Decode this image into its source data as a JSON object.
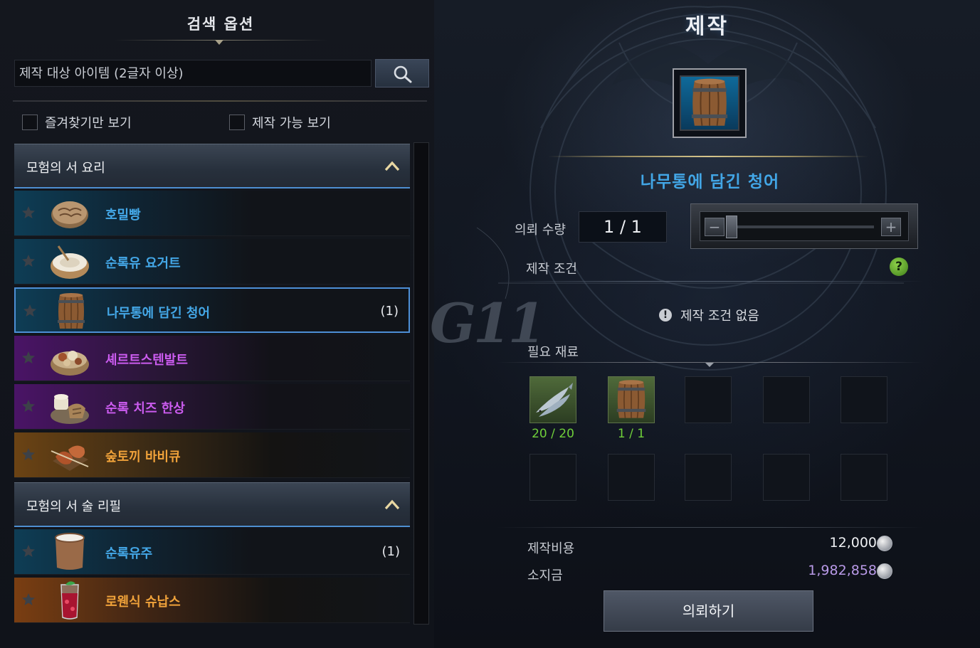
{
  "search_panel": {
    "title": "검색 옵션",
    "input_placeholder": "제작 대상 아이템 (2글자 이상)",
    "search_icon": "magnifier-icon",
    "filters": [
      {
        "label": "즐겨찾기만 보기",
        "checked": false
      },
      {
        "label": "제작 가능 보기",
        "checked": false
      }
    ]
  },
  "categories": [
    {
      "title": "모험의 서 요리",
      "expanded": true,
      "items": [
        {
          "name": "호밀빵",
          "count": "",
          "rarity": "blue",
          "icon": "bread-icon",
          "favorite": false
        },
        {
          "name": "순록유 요거트",
          "count": "",
          "rarity": "blue",
          "icon": "yogurt-bowl-icon",
          "favorite": false
        },
        {
          "name": "나무통에 담긴 청어",
          "count": "(1)",
          "rarity": "blue",
          "icon": "barrel-icon",
          "favorite": false,
          "selected": true
        },
        {
          "name": "셰르트스텐발트",
          "count": "",
          "rarity": "purple",
          "icon": "stew-bowl-icon",
          "favorite": false
        },
        {
          "name": "순록 치즈 한상",
          "count": "",
          "rarity": "purple",
          "icon": "cheese-platter-icon",
          "favorite": false
        },
        {
          "name": "숲토끼 바비큐",
          "count": "",
          "rarity": "orange",
          "icon": "barbecue-icon",
          "favorite": false
        }
      ]
    },
    {
      "title": "모험의 서 술 리필",
      "expanded": true,
      "items": [
        {
          "name": "순록유주",
          "count": "(1)",
          "rarity": "blue",
          "icon": "milk-cup-icon",
          "favorite": false
        },
        {
          "name": "로웬식 슈납스",
          "count": "",
          "rarity": "orange",
          "icon": "cocktail-glass-icon",
          "favorite": false
        }
      ]
    }
  ],
  "craft": {
    "title": "제작",
    "item_name": "나무통에 담긴 청어",
    "item_icon": "barrel-icon",
    "quantity_label": "의뢰 수량",
    "quantity_value": "1 / 1",
    "slider": {
      "decrease": "−",
      "increase": "+",
      "level": 0
    },
    "condition_label": "제작 조건",
    "help_icon": "?",
    "no_condition_text": "제작 조건 없음",
    "materials_label": "필요 재료",
    "materials": [
      {
        "icon": "herring-fish-icon",
        "count": "20 / 20"
      },
      {
        "icon": "barrel-icon",
        "count": "1 / 1"
      }
    ],
    "empty_slots": 8,
    "cost_label": "제작비용",
    "cost_value": "12,000",
    "money_label": "소지금",
    "money_value": "1,982,858",
    "request_button": "의뢰하기"
  },
  "watermark": "G11",
  "colors": {
    "blue_rarity": "#44a8e8",
    "purple_rarity": "#cc5cf0",
    "orange_rarity": "#f0a23a",
    "material_count": "#6fcf3a",
    "money": "#b99ae8",
    "selection_border": "#4d8fd6"
  }
}
